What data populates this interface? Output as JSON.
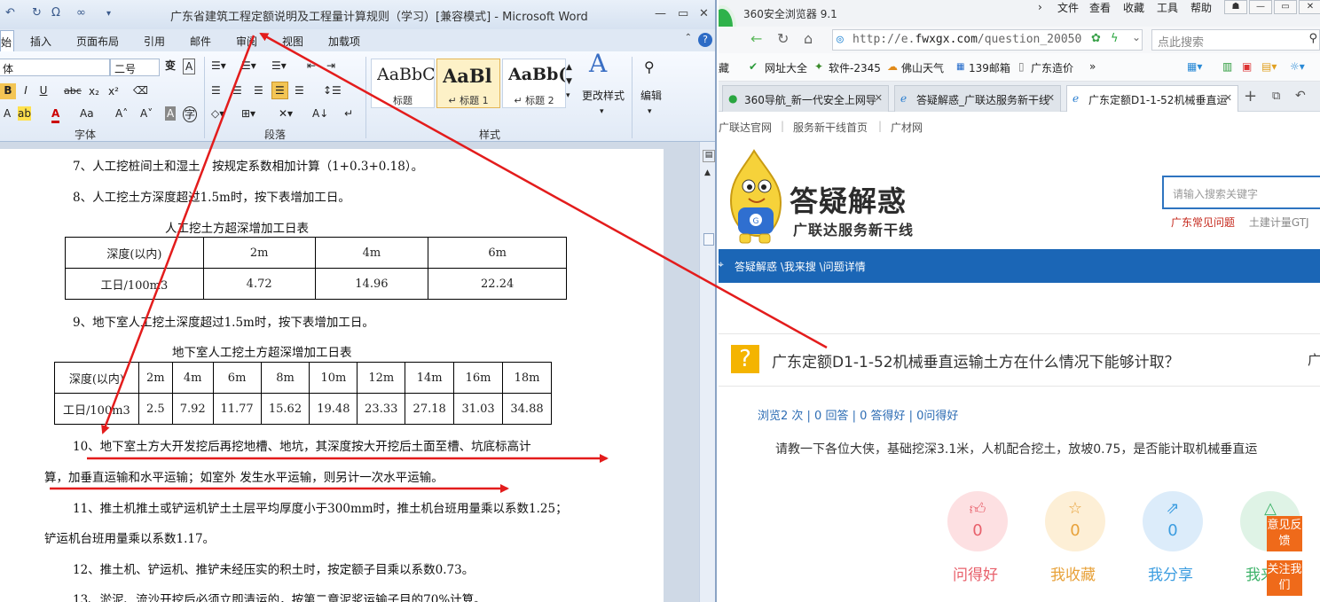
{
  "word": {
    "title": "广东省建筑工程定额说明及工程量计算规则（学习）[兼容模式] - Microsoft Word",
    "quick_access": [
      "↶",
      "↻",
      "Ω",
      "∞"
    ],
    "tabs": [
      {
        "label": "始"
      },
      {
        "label": "插入"
      },
      {
        "label": "页面布局"
      },
      {
        "label": "引用"
      },
      {
        "label": "邮件"
      },
      {
        "label": "审阅"
      },
      {
        "label": "视图"
      },
      {
        "label": "加载项"
      }
    ],
    "font_name": "体",
    "font_size": "二号",
    "groups": {
      "font": "字体",
      "paragraph": "段落",
      "styles": "样式"
    },
    "styles": [
      {
        "preview": "AaBbC",
        "name": "标题"
      },
      {
        "preview": "AaBl",
        "name": "↵ 标题 1"
      },
      {
        "preview": "AaBb(",
        "name": "↵ 标题 2"
      }
    ],
    "change_styles": "更改样式",
    "edit": "编辑",
    "lines": {
      "l7": "7、人工挖桩间土和湿土，按规定系数相加计算（1+0.3+0.18）。",
      "l8": "8、人工挖土方深度超过1.5m时，按下表增加工日。",
      "t1_caption": "人工挖土方超深增加工日表",
      "l9": "9、地下室人工挖土深度超过1.5m时，按下表增加工日。",
      "t2_caption": "地下室人工挖土方超深增加工日表",
      "l10a": "10、地下室土方大开发挖后再挖地槽、地坑，其深度按大开挖后土面至槽、坑底标高计",
      "l10b": "算，加垂直运输和水平运输；如室外 发生水平运输，则另计一次水平运输。",
      "l11a": "11、推土机推土或铲运机铲土土层平均厚度小于300mm时，推土机台班用量乘以系数1.25；",
      "l11b": "铲运机台班用量乘以系数1.17。",
      "l12": "12、推土机、铲运机、推铲未经压实的积土时，按定额子目乘以系数0.73。",
      "l13": "13、淤泥、流沙开挖后必须立即清运的，按第二章泥浆运输子目的70%计算。"
    },
    "table1": {
      "header": [
        "深度(以内)",
        "2m",
        "4m",
        "6m"
      ],
      "row": [
        "工日/100m3",
        "4.72",
        "14.96",
        "22.24"
      ]
    },
    "table2": {
      "header": [
        "深度(以内)",
        "2m",
        "4m",
        "6m",
        "8m",
        "10m",
        "12m",
        "14m",
        "16m",
        "18m"
      ],
      "row": [
        "工日/100m3",
        "2.5",
        "7.92",
        "11.77",
        "15.62",
        "19.48",
        "23.33",
        "27.18",
        "31.03",
        "34.88"
      ]
    }
  },
  "browser": {
    "app_name": "360安全浏览器 9.1",
    "menu": [
      "文件",
      "查看",
      "收藏",
      "工具",
      "帮助"
    ],
    "url_prefix": "http://e.",
    "url_host": "fwxgx.com",
    "url_path": "/question_20050",
    "search_placeholder": "点此搜索",
    "favorites": [
      "藏",
      "网址大全",
      "软件-2345",
      "佛山天气",
      "139邮箱",
      "广东造价"
    ],
    "tabs": [
      {
        "label": "360导航_新一代安全上网导"
      },
      {
        "label": "答疑解惑_广联达服务新干线"
      },
      {
        "label": "广东定额D1-1-52机械垂直运"
      }
    ],
    "toplinks": [
      "广联达官网",
      "服务新干线首页",
      "广材网"
    ],
    "brand_title": "答疑解惑",
    "brand_sub": "广联达服务新干线",
    "search_kw_placeholder": "请输入搜索关键字",
    "hot_link_1": "广东常见问题",
    "hot_link_2": "土建计量GTJ",
    "breadcrumb": "答疑解惑 \\我来搜 \\问题详情",
    "question_title": "广东定额D1-1-52机械垂直运输土方在什么情况下能够计取？",
    "question_tail": "广",
    "stats": "浏览2 次 | 0 回答 | 0 答得好 | 0问得好",
    "question_body": "请教一下各位大侠，基础挖深3.1米，人机配合挖土，放坡0.75，是否能计取机械垂直运",
    "actions": [
      {
        "label": "问得好",
        "count": "0",
        "color": "#e8606b"
      },
      {
        "label": "我收藏",
        "count": "0",
        "color": "#e8a23a"
      },
      {
        "label": "我分享",
        "count": "0",
        "color": "#3c9de0"
      },
      {
        "label": "我来",
        "count": "",
        "color": "#3fb36a"
      }
    ],
    "side_feedback": "意见反馈",
    "side_follow": "关注我们",
    "mascot_badge": "G"
  },
  "colors": {
    "arrow": "#e31c1c",
    "brand_blue": "#1b66b6",
    "feedback_orange": "#ef6a1a"
  }
}
